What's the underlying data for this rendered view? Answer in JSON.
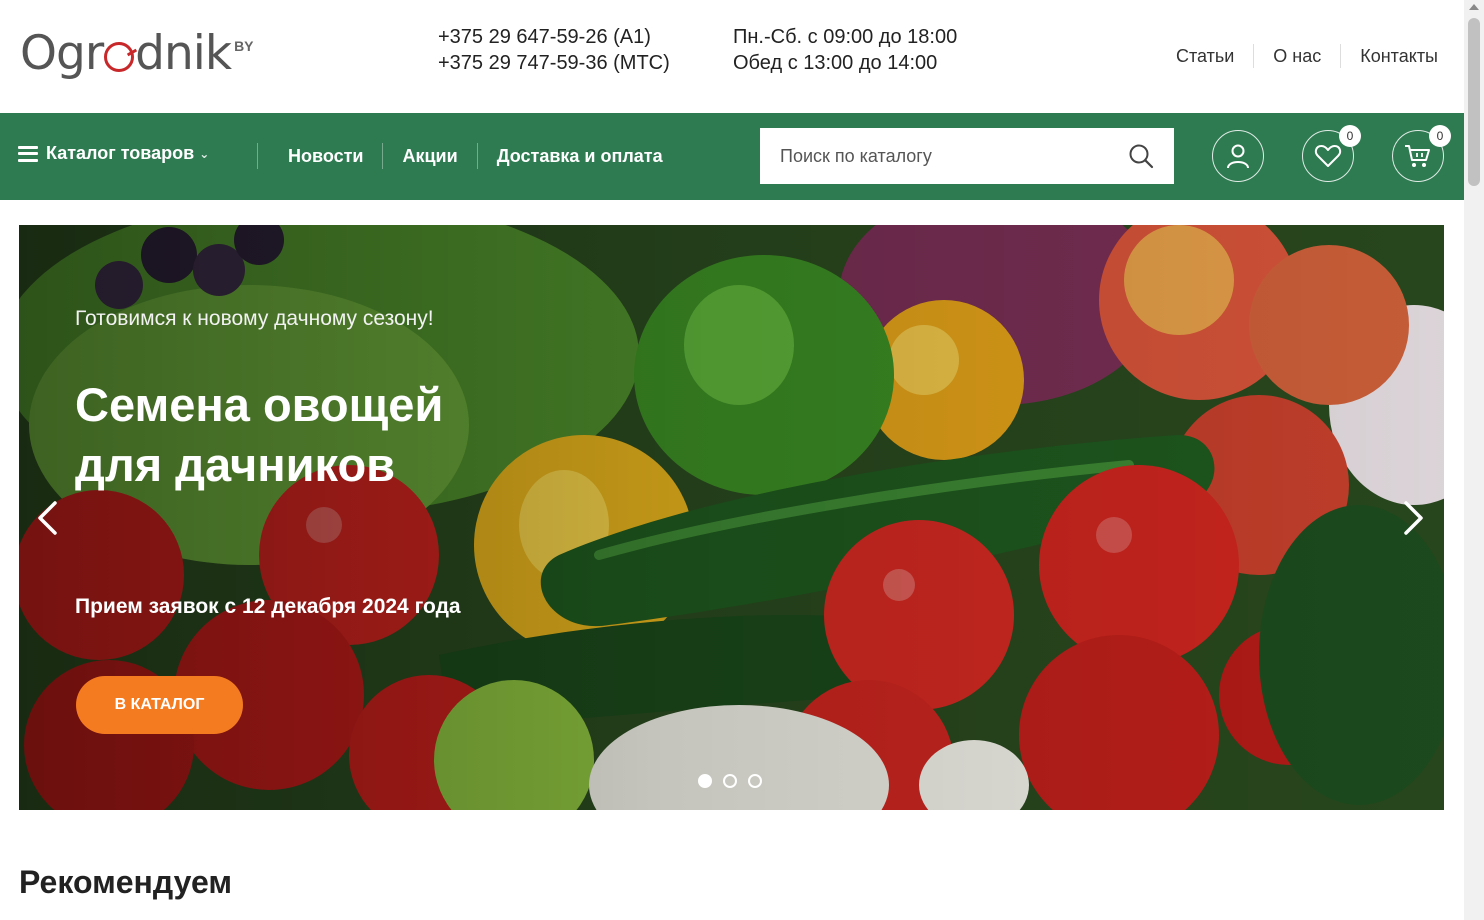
{
  "logo": {
    "pre": "Og",
    "mid": "r",
    "post": "dnik",
    "sup": "BY"
  },
  "contacts": {
    "phone1": "+375 29 647-59-26 (A1)",
    "phone2": "+375 29 747-59-36 (МТС)",
    "hours1": "Пн.-Сб. с 09:00 до 18:00",
    "hours2": "Обед с 13:00 до 14:00"
  },
  "top_links": [
    "Статьи",
    "О нас",
    "Контакты"
  ],
  "nav": {
    "catalog_label": "Каталог товаров",
    "links": [
      "Новости",
      "Акции",
      "Доставка и оплата"
    ],
    "search_placeholder": "Поиск по каталогу",
    "wishlist_count": "0",
    "cart_count": "0"
  },
  "hero": {
    "subtitle": "Готовимся к новому дачному сезону!",
    "title": "Семена овощей для дачников",
    "date": "Прием заявок с 12 декабря 2024 года",
    "button": "В КАТАЛОГ",
    "slides_total": 3,
    "active_slide": 1
  },
  "section_title": "Рекомендуем",
  "colors": {
    "nav_green": "#2e7b52",
    "accent_orange": "#f47b20",
    "logo_red": "#c8282a"
  }
}
